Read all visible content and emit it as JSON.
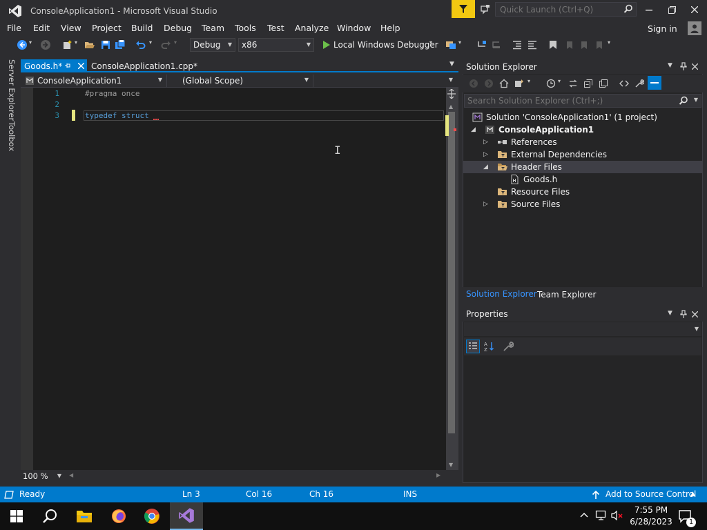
{
  "window": {
    "title": "ConsoleApplication1 - Microsoft Visual Studio",
    "quick_launch_placeholder": "Quick Launch (Ctrl+Q)",
    "sign_in": "Sign in"
  },
  "menu": [
    "File",
    "Edit",
    "View",
    "Project",
    "Build",
    "Debug",
    "Team",
    "Tools",
    "Test",
    "Analyze",
    "Window",
    "Help"
  ],
  "toolbar": {
    "configuration": "Debug",
    "platform": "x86",
    "run_label": "Local Windows Debugger"
  },
  "left_strip": {
    "server_explorer": "Server Explorer",
    "toolbox": "Toolbox"
  },
  "editor": {
    "tabs": [
      {
        "label": "Goods.h*",
        "active": true
      },
      {
        "label": "ConsoleApplication1.cpp*",
        "active": false
      }
    ],
    "nav": {
      "project": "ConsoleApplication1",
      "scope": "(Global Scope)",
      "member": ""
    },
    "lines": [
      {
        "number": "1",
        "text": "#pragma once"
      },
      {
        "number": "2",
        "text": ""
      },
      {
        "number": "3",
        "text": "typedef struct"
      }
    ],
    "zoom": "100 %"
  },
  "solution_explorer": {
    "title": "Solution Explorer",
    "search_placeholder": "Search Solution Explorer (Ctrl+;)",
    "tree": {
      "solution": "Solution 'ConsoleApplication1' (1 project)",
      "project": "ConsoleApplication1",
      "references": "References",
      "external_dependencies": "External Dependencies",
      "header_files": "Header Files",
      "goods_h": "Goods.h",
      "resource_files": "Resource Files",
      "source_files": "Source Files"
    },
    "tabs": {
      "solution_explorer": "Solution Explorer",
      "team_explorer": "Team Explorer"
    }
  },
  "properties": {
    "title": "Properties"
  },
  "status": {
    "state": "Ready",
    "line": "Ln 3",
    "col": "Col 16",
    "ch": "Ch 16",
    "mode": "INS",
    "source_control": "Add to Source Control"
  },
  "taskbar": {
    "time": "7:55 PM",
    "date": "6/28/2023",
    "notifications_count": "1"
  },
  "colors": {
    "accent": "#007acc",
    "editor_bg": "#1e1e1e",
    "keyword": "#569cd6",
    "preprocessor": "#9b9b9b",
    "line_numbers": "#2b91af",
    "notification_flag": "#f2c811"
  }
}
